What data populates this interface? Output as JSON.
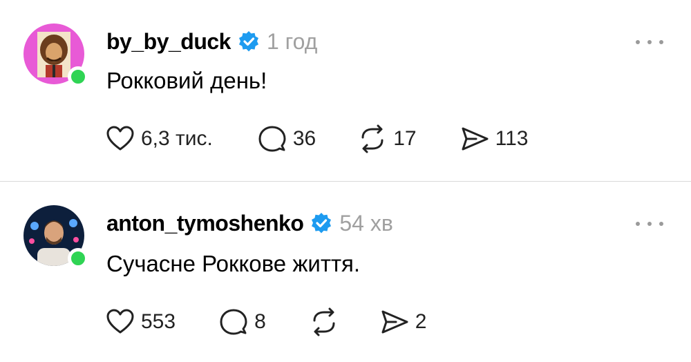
{
  "posts": [
    {
      "username": "by_by_duck",
      "time": "1 год",
      "text": "Рокковий день!",
      "likes": "6,3 тис.",
      "comments": "36",
      "reposts": "17",
      "shares": "113"
    },
    {
      "username": "anton_tymoshenko",
      "time": "54 хв",
      "text": "Сучасне Роккове життя.",
      "likes": "553",
      "comments": "8",
      "reposts": "",
      "shares": "2"
    }
  ],
  "colors": {
    "verified": "#1d9bf0",
    "online": "#2fd454",
    "muted": "#a0a0a0",
    "avatar0_bg": "#e85ad6"
  }
}
